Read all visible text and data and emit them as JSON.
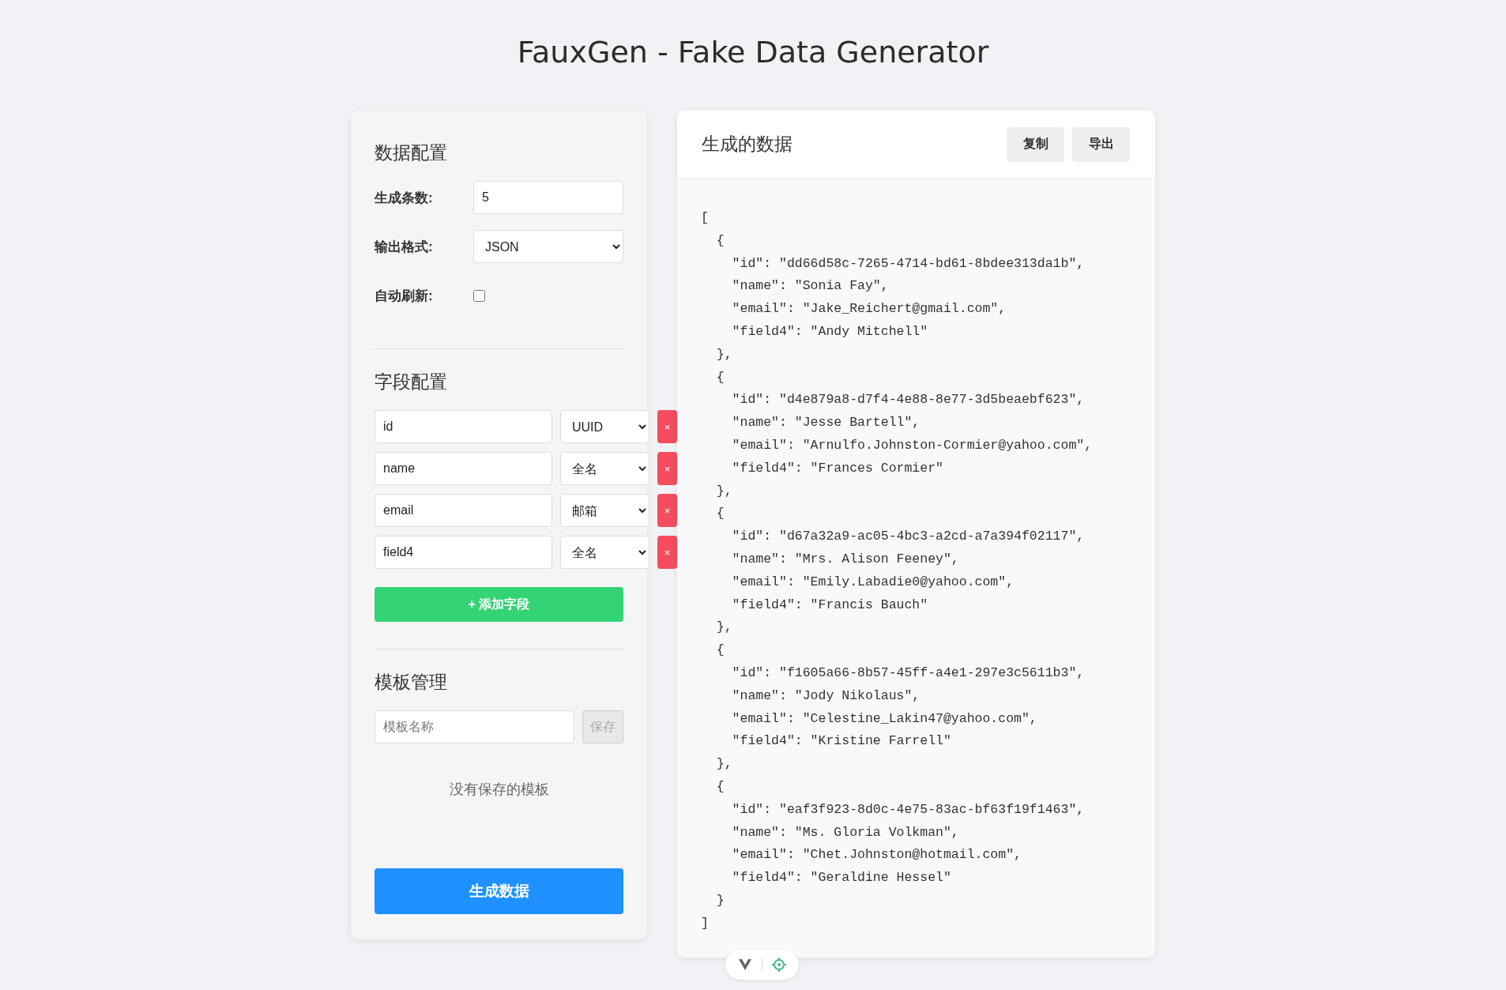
{
  "title": "FauxGen - Fake Data Generator",
  "config": {
    "heading": "数据配置",
    "count": {
      "label": "生成条数:",
      "value": "5"
    },
    "format": {
      "label": "输出格式:",
      "value": "JSON"
    },
    "auto_refresh": {
      "label": "自动刷新:",
      "checked": false
    }
  },
  "fields": {
    "heading": "字段配置",
    "items": [
      {
        "name": "id",
        "type": "UUID",
        "remove": "×"
      },
      {
        "name": "name",
        "type": "全名",
        "remove": "×"
      },
      {
        "name": "email",
        "type": "邮箱",
        "remove": "×"
      },
      {
        "name": "field4",
        "type": "全名",
        "remove": "×"
      }
    ],
    "add_button": "+ 添加字段"
  },
  "templates": {
    "heading": "模板管理",
    "name_placeholder": "模板名称",
    "save_button": "保存",
    "save_disabled": true,
    "empty_text": "没有保存的模板"
  },
  "generate_button": "生成数据",
  "output": {
    "title": "生成的数据",
    "buttons": [
      "复制",
      "导出"
    ],
    "lines": [
      "[",
      "  {",
      "    \"id\": \"dd66d58c-7265-4714-bd61-8bdee313da1b\",",
      "    \"name\": \"Sonia Fay\",",
      "    \"email\": \"Jake_Reichert@gmail.com\",",
      "    \"field4\": \"Andy Mitchell\"",
      "  },",
      "  {",
      "    \"id\": \"d4e879a8-d7f4-4e88-8e77-3d5beaebf623\",",
      "    \"name\": \"Jesse Bartell\",",
      "    \"email\": \"Arnulfo.Johnston-Cormier@yahoo.com\",",
      "    \"field4\": \"Frances Cormier\"",
      "  },",
      "  {",
      "    \"id\": \"d67a32a9-ac05-4bc3-a2cd-a7a394f02117\",",
      "    \"name\": \"Mrs. Alison Feeney\",",
      "    \"email\": \"Emily.Labadie0@yahoo.com\",",
      "    \"field4\": \"Francis Bauch\"",
      "  },",
      "  {",
      "    \"id\": \"f1605a66-8b57-45ff-a4e1-297e3c5611b3\",",
      "    \"name\": \"Jody Nikolaus\",",
      "    \"email\": \"Celestine_Lakin47@yahoo.com\",",
      "    \"field4\": \"Kristine Farrell\"",
      "  },",
      "  {",
      "    \"id\": \"eaf3f923-8d0c-4e75-83ac-bf63f19f1463\",",
      "    \"name\": \"Ms. Gloria Volkman\",",
      "    \"email\": \"Chet.Johnston@hotmail.com\",",
      "    \"field4\": \"Geraldine Hessel\"",
      "  }",
      "]"
    ]
  }
}
